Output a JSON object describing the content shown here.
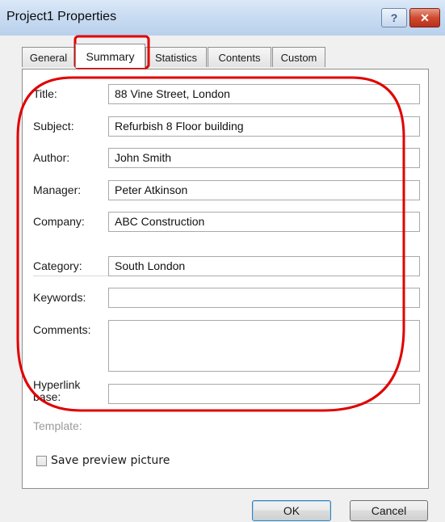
{
  "window": {
    "title": "Project1 Properties",
    "help_glyph": "?",
    "close_glyph": "✕"
  },
  "tabs": [
    {
      "label": "General",
      "active": false
    },
    {
      "label": "Summary",
      "active": true
    },
    {
      "label": "Statistics",
      "active": false
    },
    {
      "label": "Contents",
      "active": false
    },
    {
      "label": "Custom",
      "active": false
    }
  ],
  "fields": {
    "title": {
      "label": "Title:",
      "value": "88 Vine Street, London"
    },
    "subject": {
      "label": "Subject:",
      "value": "Refurbish 8 Floor building"
    },
    "author": {
      "label": "Author:",
      "value": "John Smith"
    },
    "manager": {
      "label": "Manager:",
      "value": "Peter Atkinson"
    },
    "company": {
      "label": "Company:",
      "value": "ABC Construction"
    },
    "category": {
      "label": "Category:",
      "value": "South London"
    },
    "keywords": {
      "label": "Keywords:",
      "value": ""
    },
    "comments": {
      "label": "Comments:",
      "value": ""
    },
    "hyperlink_base": {
      "label_line1": "Hyperlink",
      "label_line2": "base:",
      "value": ""
    },
    "template": {
      "label": "Template:"
    }
  },
  "save_preview": {
    "label": "Save preview picture",
    "checked": false
  },
  "buttons": {
    "ok": "OK",
    "cancel": "Cancel"
  },
  "colors": {
    "annotation": "#e00000",
    "close_button": "#c8452b"
  }
}
